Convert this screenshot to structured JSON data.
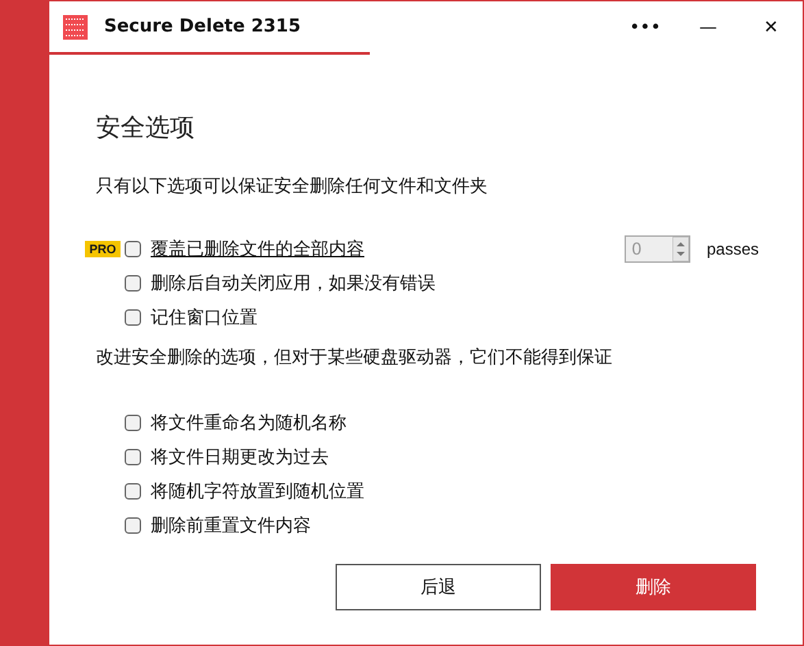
{
  "window": {
    "title": "Secure Delete 2315",
    "controls": [
      "•••",
      "—",
      "✕"
    ]
  },
  "heading": "安全选项",
  "section_1": {
    "text": "只有以下选项可以保证安全删除任何文件和文件夹",
    "options": [
      {
        "kind": "pro",
        "badge": "PRO",
        "label": "覆盖已删除文件的全部内容",
        "checked": false,
        "spinner": {
          "value": "0",
          "disabled": true,
          "unit": "passes"
        }
      },
      {
        "kind": "basic",
        "label": "删除后自动关闭应用，如果没有错误",
        "checked": false
      },
      {
        "kind": "basic",
        "label": "记住窗口位置",
        "checked": false
      }
    ]
  },
  "section_2": {
    "text": "改进安全删除的选项，但对于某些硬盘驱动器，它们不能得到保证",
    "options": [
      {
        "kind": "basic",
        "label": "将文件重命名为随机名称",
        "checked": false
      },
      {
        "kind": "basic",
        "label": "将文件日期更改为过去",
        "checked": false
      },
      {
        "kind": "basic",
        "label": "将随机字符放置到随机位置",
        "checked": false
      },
      {
        "kind": "basic",
        "label": "删除前重置文件内容",
        "checked": false
      }
    ]
  },
  "buttons": [
    {
      "label": "后退",
      "kind": "secondary"
    },
    {
      "label": "删除",
      "kind": "primary"
    }
  ]
}
